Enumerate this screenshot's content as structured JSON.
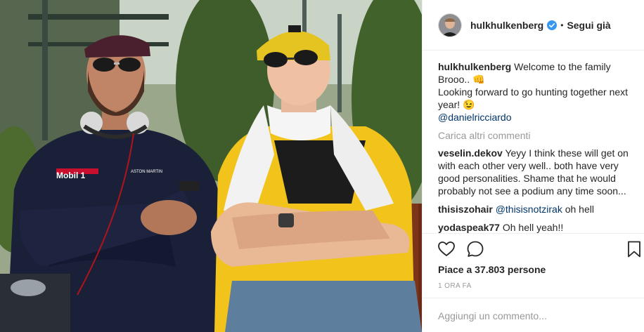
{
  "post": {
    "username": "hulkhulkenberg",
    "separator": "•",
    "follow_label": "Segui già",
    "caption": {
      "username": "hulkhulkenberg",
      "line1": "Welcome to the family Brooo..",
      "line2": "Looking forward to go hunting together next year!",
      "mention": "@danielricciardo"
    },
    "load_more": "Carica altri commenti",
    "comments": [
      {
        "user": "veselin.dekov",
        "text": "Yeyy I think these will get on with each other very well.. both have very good personalities. Shame that he would probably not see a podium any time soon..."
      },
      {
        "user": "thisiszohair",
        "mention": "@thisisnotzirak",
        "text": "oh hell"
      },
      {
        "user": "yodaspeak77",
        "text": "Oh hell yeah!!"
      }
    ],
    "likes": "Piace a 37.803 persone",
    "time": "1 ORA FA",
    "comment_placeholder": "Aggiungi un commento...",
    "emoji": {
      "fist": "👊",
      "wink": "😉"
    }
  },
  "photo": {
    "sponsor_text_1": "Mobil 1",
    "sponsor_text_2": "ASTON MARTIN"
  },
  "colors": {
    "verified": "#3897f0",
    "mention": "#003569",
    "muted": "#999999"
  }
}
